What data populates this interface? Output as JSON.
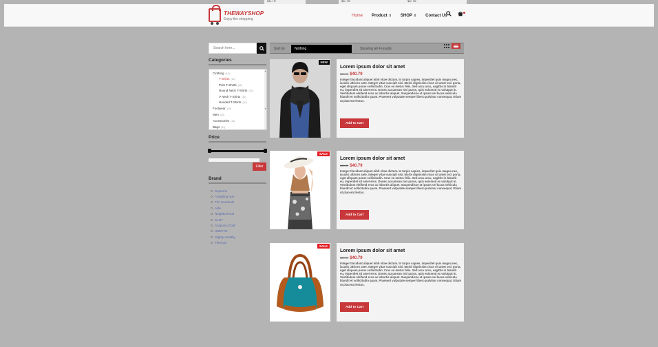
{
  "top_peek": [
    "$0.79",
    "$0.79",
    "$0.79"
  ],
  "header": {
    "brand": "THEWAYSHOP",
    "tagline": "Enjoy the shopping",
    "nav": [
      {
        "label": "Home",
        "active": true
      },
      {
        "label": "Product",
        "has_menu": true
      },
      {
        "label": "SHOP",
        "has_menu": true
      },
      {
        "label": "Contact Us"
      }
    ],
    "icons": [
      "search-icon",
      "cart-icon"
    ]
  },
  "sidebar": {
    "search_placeholder": "Search here...",
    "categories_title": "Categories",
    "categories": [
      {
        "label": "Clothing",
        "count": "(10)"
      },
      {
        "label": "T-Shirts",
        "count": "(10)",
        "selected": true
      },
      {
        "label": "Polo T-Shirts",
        "count": "(10)"
      },
      {
        "label": "Round Neck T-Shirts",
        "count": "(10)"
      },
      {
        "label": "V Neck T-Shirts",
        "count": "(10)"
      },
      {
        "label": "Hooded T-Shirts",
        "count": "(10)"
      },
      {
        "label": "Footwear",
        "count": "(10)"
      },
      {
        "label": "Men",
        "count": "(10)"
      },
      {
        "label": "Accessories",
        "count": "(11)"
      },
      {
        "label": "Bags",
        "count": "(11)"
      }
    ],
    "price_title": "Price",
    "filter_label": "Filter",
    "brand_title": "Brand",
    "brands": [
      "Supreme",
      "A Bathing Ape",
      "The Hundreds",
      "Alife",
      "Neighborhood",
      "CLOT",
      "Acapulco Gold",
      "UNDFTD",
      "Mighty Healthy",
      "Fiberops"
    ]
  },
  "toolbar": {
    "sort_label": "Sort by",
    "sort_value": "Nothing",
    "showing": "Showing all 4 results"
  },
  "products": [
    {
      "badge": "NEW",
      "title": "Lorem ipsum dolor sit amet",
      "old_price": "$60.00",
      "price": "$40.79",
      "description": "Integer tincidunt aliquet nibh vitae dictum. In turpis sapien, imperdiet quis magna nec, iaculis ultrices ante. Integer vitae suscipit nisi. Morbi dignissim risus sit amet orci porta, eget aliquam purus sollicitudin. Cras eu metus felis. Sed arcu arcu, sagittis in blandit eu, imperdiet sit amet eros. Donec accumsan nisi purus, quis euismod ex volutpat in. Vestibulum eleifend eros ac lobortis aliquet. Suspendisse at ipsum vel lacus vehicula blandit et sollicitudin quam. Praesent vulputate semper libero pulvinar consequat. Etiam ut placerat lectus.",
      "cart_label": "Add to Cart"
    },
    {
      "badge": "SALE",
      "title": "Lorem ipsum dolor sit amet",
      "old_price": "$60.00",
      "price": "$40.79",
      "description": "Integer tincidunt aliquet nibh vitae dictum. In turpis sapien, imperdiet quis magna nec, iaculis ultrices ante. Integer vitae suscipit nisi. Morbi dignissim risus sit amet orci porta, eget aliquam purus sollicitudin. Cras eu metus felis. Sed arcu arcu, sagittis in blandit eu, imperdiet sit amet eros. Donec accumsan nisi purus, quis euismod ex volutpat in. Vestibulum eleifend eros ac lobortis aliquet. Suspendisse at ipsum vel lacus vehicula blandit et sollicitudin quam. Praesent vulputate semper libero pulvinar consequat. Etiam ut placerat lectus.",
      "cart_label": "Add to Cart"
    },
    {
      "badge": "SALE",
      "title": "Lorem ipsum dolor sit amet",
      "old_price": "$60.00",
      "price": "$40.79",
      "description": "Integer tincidunt aliquet nibh vitae dictum. In turpis sapien, imperdiet quis magna nec, iaculis ultrices ante. Integer vitae suscipit nisi. Morbi dignissim risus sit amet orci porta, eget aliquam purus sollicitudin. Cras eu metus felis. Sed arcu arcu, sagittis in blandit eu, imperdiet sit amet eros. Donec accumsan nisi purus, quis euismod ex volutpat in. Vestibulum eleifend eros ac lobortis aliquet. Suspendisse at ipsum vel lacus vehicula blandit et sollicitudin quam. Praesent vulputate semper libero pulvinar consequat. Etiam ut placerat lectus.",
      "cart_label": "Add to Cart"
    }
  ],
  "colors": {
    "accent": "#c8383a",
    "sale": "#e31e24",
    "page_bg": "#b4b4b4"
  }
}
